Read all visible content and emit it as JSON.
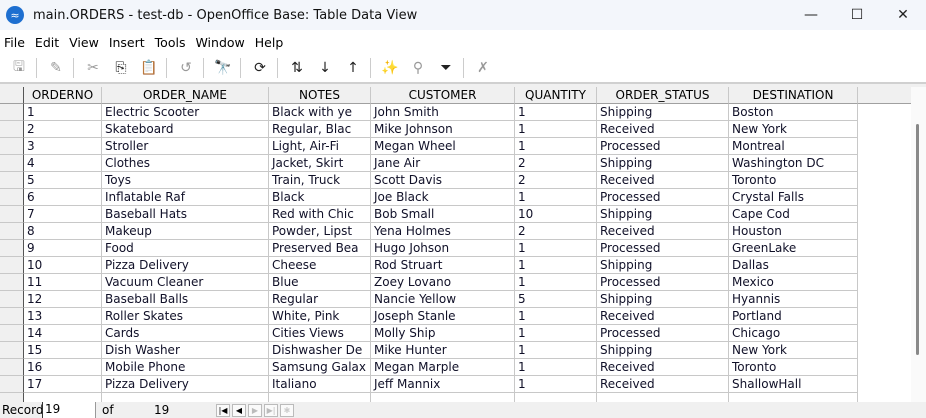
{
  "window": {
    "title": "main.ORDERS - test-db - OpenOffice Base: Table Data View",
    "minimize": "—",
    "maximize": "☐",
    "close": "✕"
  },
  "menu": [
    "File",
    "Edit",
    "View",
    "Insert",
    "Tools",
    "Window",
    "Help"
  ],
  "toolbar": [
    {
      "icon": "save-icon",
      "glyph": "🖫",
      "enabled": false
    },
    {
      "icon": "edit-icon",
      "glyph": "✎",
      "enabled": false
    },
    {
      "icon": "cut-icon",
      "glyph": "✂",
      "enabled": false
    },
    {
      "icon": "copy-icon",
      "glyph": "⎘",
      "enabled": true
    },
    {
      "icon": "paste-icon",
      "glyph": "📋",
      "enabled": false
    },
    {
      "icon": "undo-icon",
      "glyph": "↺",
      "enabled": false
    },
    {
      "icon": "find-icon",
      "glyph": "🔭",
      "enabled": true
    },
    {
      "icon": "refresh-icon",
      "glyph": "⟳",
      "enabled": true
    },
    {
      "icon": "sort-icon",
      "glyph": "⇅",
      "enabled": true
    },
    {
      "icon": "sort-ascending-icon",
      "glyph": "↓",
      "enabled": true
    },
    {
      "icon": "sort-descending-icon",
      "glyph": "↑",
      "enabled": true
    },
    {
      "icon": "autofilter-icon",
      "glyph": "✨",
      "enabled": true
    },
    {
      "icon": "standard-filter-icon",
      "glyph": "⚲",
      "enabled": false
    },
    {
      "icon": "filter-icon",
      "glyph": "⏷",
      "enabled": true
    },
    {
      "icon": "remove-filter-icon",
      "glyph": "✗",
      "enabled": false
    }
  ],
  "table": {
    "columns": [
      "ORDERNO",
      "ORDER_NAME",
      "NOTES",
      "CUSTOMER",
      "QUANTITY",
      "ORDER_STATUS",
      "DESTINATION"
    ],
    "rows": [
      [
        "1",
        "Electric Scooter",
        "Black with ye",
        "John Smith",
        "1",
        "Shipping",
        "Boston"
      ],
      [
        "2",
        "Skateboard",
        "Regular, Blac",
        "Mike Johnson",
        "1",
        "Received",
        "New York"
      ],
      [
        "3",
        "Stroller",
        "Light, Air-Fi",
        "Megan Wheel",
        "1",
        "Processed",
        "Montreal"
      ],
      [
        "4",
        "Clothes",
        "Jacket, Skirt",
        "Jane Air",
        "2",
        "Shipping",
        "Washington DC"
      ],
      [
        "5",
        "Toys",
        "Train, Truck",
        "Scott Davis",
        "2",
        "Received",
        "Toronto"
      ],
      [
        "6",
        "Inflatable Raf",
        "Black",
        "Joe Black",
        "1",
        "Processed",
        "Crystal Falls"
      ],
      [
        "7",
        "Baseball Hats",
        "Red with Chic",
        "Bob Small",
        "10",
        "Shipping",
        "Cape Cod"
      ],
      [
        "8",
        "Makeup",
        "Powder, Lipst",
        "Yena Holmes",
        "2",
        "Received",
        "Houston"
      ],
      [
        "9",
        "Food",
        "Preserved Bea",
        "Hugo Johson",
        "1",
        "Processed",
        "GreenLake"
      ],
      [
        "10",
        "Pizza Delivery",
        "Cheese",
        "Rod Struart",
        "1",
        "Shipping",
        "Dallas"
      ],
      [
        "11",
        "Vacuum Cleaner",
        "Blue",
        "Zoey Lovano",
        "1",
        "Processed",
        "Mexico"
      ],
      [
        "12",
        "Baseball Balls",
        "Regular",
        "Nancie Yellow",
        "5",
        "Shipping",
        "Hyannis"
      ],
      [
        "13",
        "Roller Skates",
        "White, Pink",
        "Joseph Stanle",
        "1",
        "Received",
        "Portland"
      ],
      [
        "14",
        "Cards",
        "Cities Views",
        "Molly Ship",
        "1",
        "Processed",
        "Chicago"
      ],
      [
        "15",
        "Dish Washer",
        "Dishwasher De",
        "Mike Hunter",
        "1",
        "Shipping",
        "New York"
      ],
      [
        "16",
        "Mobile Phone",
        "Samsung Galax",
        "Megan Marple",
        "1",
        "Received",
        "Toronto"
      ],
      [
        "17",
        "Pizza Delivery",
        "Italiano",
        "Jeff Mannix",
        "1",
        "Received",
        "ShallowHall"
      ]
    ]
  },
  "status": {
    "record_label": "Record",
    "record_value": "19",
    "of_label": "of",
    "total": "19"
  }
}
